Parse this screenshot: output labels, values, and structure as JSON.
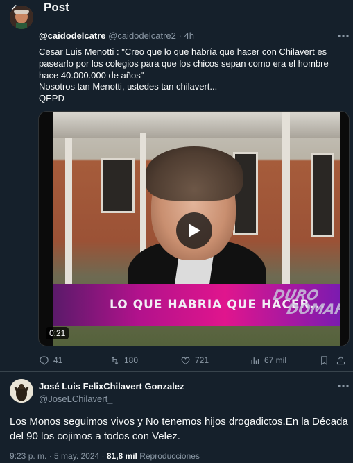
{
  "header": {
    "title": "Post"
  },
  "tweet": {
    "handle": "@caidodelcatre",
    "username": "@caidodelcatre2",
    "separator": "·",
    "time": "4h",
    "lines": [
      "Cesar Luis Menotti : \"Creo que lo que habría que hacer con Chilavert es",
      "pasearlo por los colegios para que los chicos sepan como era el hombre",
      "hace 40.000.000 de años\"",
      "Nosotros tan Menotti,  ustedes tan chilavert...",
      "QEPD"
    ],
    "video": {
      "caption": "LO QUE HABRIA QUE HACER...",
      "logo_top": "DURO",
      "logo_bottom": "DOMAR",
      "duration": "0:21"
    },
    "actions": {
      "replies": "41",
      "reposts": "180",
      "likes": "721",
      "views": "67 mil"
    }
  },
  "reply": {
    "name": "José Luis FelixChilavert Gonzalez",
    "handle": "@JoseLChilavert_",
    "lines": [
      "Los Monos seguimos vivos y No tenemos hijos drogadictos.En la Década",
      "del 90 los cojimos a todos con Velez."
    ],
    "footer": {
      "time": "9:23 p. m. · 5 may. 2024 · ",
      "views": "81,8 mil",
      "views_label": " Reproducciones"
    }
  },
  "colors": {
    "background": "#15202b",
    "text": "#f7f9f9",
    "muted": "#8b98a5",
    "divider": "#38444d"
  },
  "icons": [
    "back-arrow-icon",
    "more-icon",
    "reply-icon",
    "repost-icon",
    "like-icon",
    "views-icon",
    "bookmark-icon",
    "share-icon",
    "play-icon"
  ]
}
